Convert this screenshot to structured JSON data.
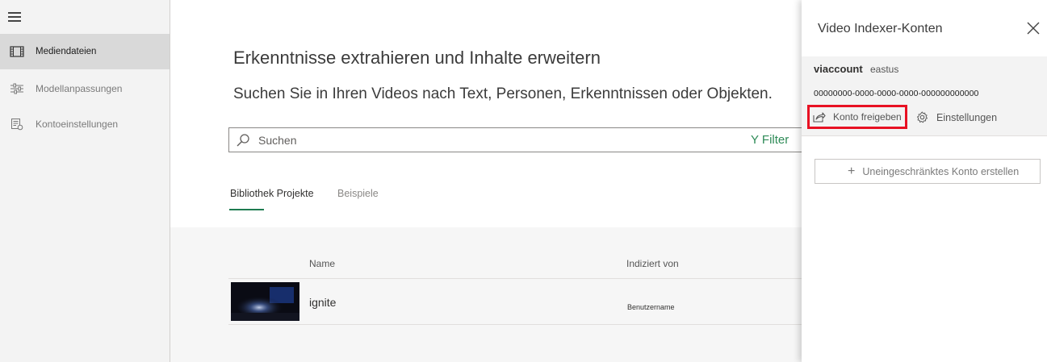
{
  "sidebar": {
    "menu_icon": "hamburger-icon",
    "items": [
      {
        "label": "Mediendateien",
        "icon": "film-icon",
        "active": true
      },
      {
        "label": "Modellanpassungen",
        "icon": "sliders-icon",
        "active": false
      },
      {
        "label": "Kontoeinstellungen",
        "icon": "account-settings-icon",
        "active": false
      }
    ]
  },
  "main": {
    "heading": "Erkenntnisse extrahieren und Inhalte erweitern",
    "subheading": "Suchen Sie in Ihren Videos nach Text, Personen, Erkenntnissen oder Objekten.",
    "search": {
      "placeholder": "Suchen",
      "filter_label": "Y Filter"
    },
    "tabs": [
      {
        "label": "Bibliothek Projekte",
        "active": true
      },
      {
        "label": "Beispiele",
        "active": false
      }
    ],
    "table": {
      "columns": [
        "Name",
        "Indiziert von"
      ],
      "rows": [
        {
          "name": "ignite",
          "indexed_by": "Benutzername"
        }
      ]
    }
  },
  "panel": {
    "title": "Video Indexer-Konten",
    "account": {
      "name": "viaccount",
      "region": "eastus",
      "id": "00000000-0000-0000-0000-000000000000"
    },
    "share_label": "Konto freigeben",
    "settings_label": "Einstellungen",
    "create_label": "Uneingeschränktes Konto erstellen"
  },
  "colors": {
    "accent_green": "#2e8b57",
    "highlight_red": "#e81123",
    "sidebar_bg": "#f3f3f3",
    "sidebar_active_bg": "#d9d9d9"
  }
}
